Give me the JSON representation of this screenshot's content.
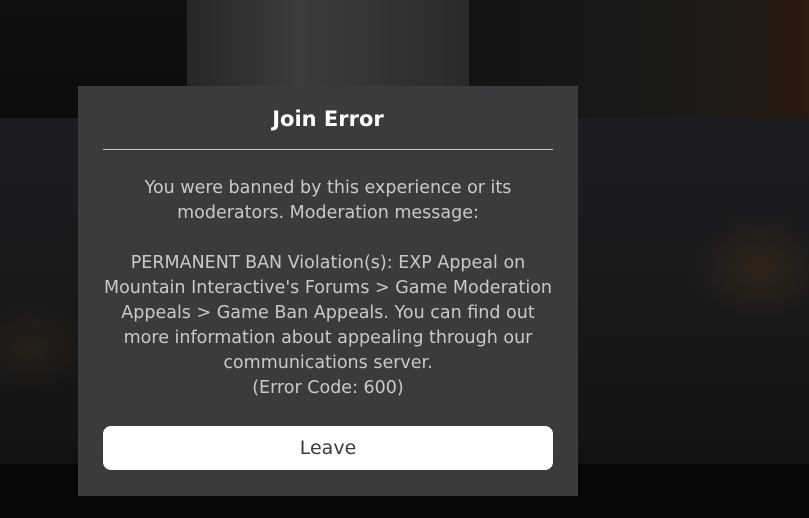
{
  "dialog": {
    "title": "Join Error",
    "message_intro": "You were banned by this experience or its moderators. Moderation message:",
    "message_body": "PERMANENT BAN Violation(s): EXP Appeal on Mountain Interactive's Forums > Game Moderation Appeals > Game Ban Appeals. You can find out more information about appealing through our communications server.",
    "error_code": "(Error Code: 600)",
    "leave_label": "Leave"
  },
  "colors": {
    "dialog_background": "#393b3d",
    "title_text": "#ffffff",
    "message_text": "#c9c9c9",
    "button_background": "#ffffff",
    "button_text": "#393b3d"
  }
}
